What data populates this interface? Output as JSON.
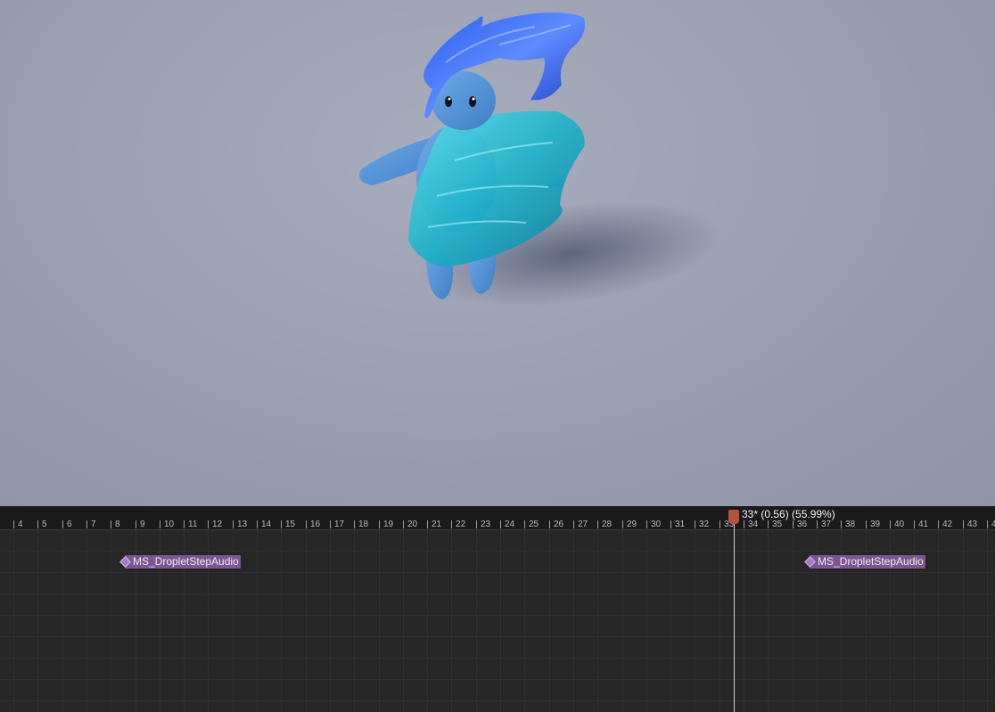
{
  "viewport": {
    "background_color": "#9ca1b2",
    "character": "water-droplet-character"
  },
  "timeline": {
    "ticks": [
      "4",
      "5",
      "6",
      "7",
      "8",
      "9",
      "10",
      "11",
      "12",
      "13",
      "14",
      "15",
      "16",
      "17",
      "18",
      "19",
      "20",
      "21",
      "22",
      "23",
      "24",
      "25",
      "26",
      "27",
      "28",
      "29",
      "30",
      "31",
      "32",
      "33",
      "34",
      "35",
      "36",
      "37",
      "38",
      "39",
      "40",
      "41",
      "42",
      "43",
      "4"
    ],
    "playhead": {
      "readout": "33* (0.56) (55.99%)",
      "color": "#b2533e"
    },
    "notifies": [
      {
        "label": "MS_DropletStepAudio",
        "color": "#7d5494"
      },
      {
        "label": "MS_DropletStepAudio",
        "color": "#7d5494"
      }
    ]
  }
}
